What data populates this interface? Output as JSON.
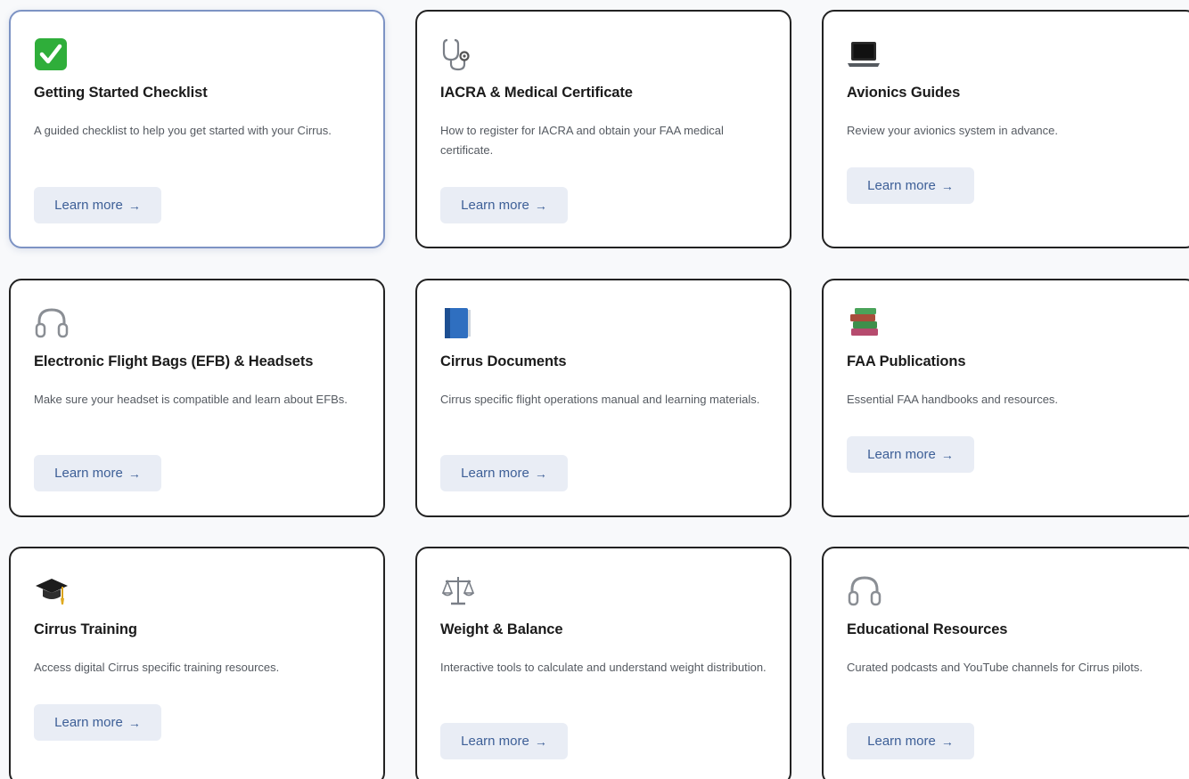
{
  "cards": [
    {
      "icon": "check-mark-icon",
      "title": "Getting Started Checklist",
      "description": "A guided checklist to help you get started with your Cirrus.",
      "button_label": "Learn more",
      "button_arrow": "→"
    },
    {
      "icon": "stethoscope-icon",
      "title": "IACRA & Medical Certificate",
      "description": "How to register for IACRA and obtain your FAA medical certificate.",
      "button_label": "Learn more",
      "button_arrow": "→"
    },
    {
      "icon": "laptop-icon",
      "title": "Avionics Guides",
      "description": "Review your avionics system in advance.",
      "button_label": "Learn more",
      "button_arrow": "→"
    },
    {
      "icon": "headphones-icon",
      "title": "Electronic Flight Bags (EFB) & Headsets",
      "description": "Make sure your headset is compatible and learn about EFBs.",
      "button_label": "Learn more",
      "button_arrow": "→"
    },
    {
      "icon": "blue-book-icon",
      "title": "Cirrus Documents",
      "description": "Cirrus specific flight operations manual and learning materials.",
      "button_label": "Learn more",
      "button_arrow": "→"
    },
    {
      "icon": "books-stack-icon",
      "title": "FAA Publications",
      "description": "Essential FAA handbooks and resources.",
      "button_label": "Learn more",
      "button_arrow": "→"
    },
    {
      "icon": "graduation-cap-icon",
      "title": "Cirrus Training",
      "description": "Access digital Cirrus specific training resources.",
      "button_label": "Learn more",
      "button_arrow": "→"
    },
    {
      "icon": "balance-scale-icon",
      "title": "Weight & Balance",
      "description": "Interactive tools to calculate and understand weight distribution.",
      "button_label": "Learn more",
      "button_arrow": "→"
    },
    {
      "icon": "headphones-icon",
      "title": "Educational Resources",
      "description": "Curated podcasts and YouTube channels for Cirrus pilots.",
      "button_label": "Learn more",
      "button_arrow": "→"
    }
  ],
  "colors": {
    "card_border": "#222222",
    "active_border": "#7d93c4",
    "button_bg": "#e9edf5",
    "button_text": "#3d5f97",
    "check_green": "#2fae3a"
  }
}
